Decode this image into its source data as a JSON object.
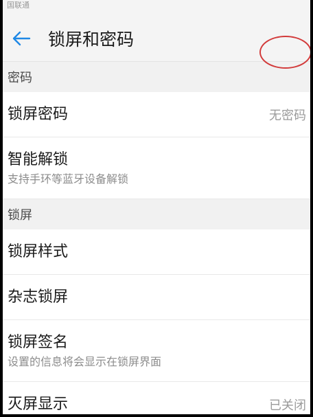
{
  "status": {
    "carrier": "国联通"
  },
  "header": {
    "title": "锁屏和密码",
    "back_icon": "arrow-left-icon",
    "accent": "#1e88e5"
  },
  "sections": {
    "password": {
      "label": "密码",
      "lock_password": {
        "label": "锁屏密码",
        "value": "无密码"
      },
      "smart_unlock": {
        "label": "智能解锁",
        "subtitle": "支持手环等蓝牙设备解锁"
      }
    },
    "lockscreen": {
      "label": "锁屏",
      "style": {
        "label": "锁屏样式"
      },
      "magazine": {
        "label": "杂志锁屏"
      },
      "signature": {
        "label": "锁屏签名",
        "subtitle": "设置的信息将会显示在锁屏界面"
      },
      "screen_off_display": {
        "label": "灭屏显示",
        "value": "已关闭"
      }
    }
  },
  "annotation_color": "#d23a3a"
}
